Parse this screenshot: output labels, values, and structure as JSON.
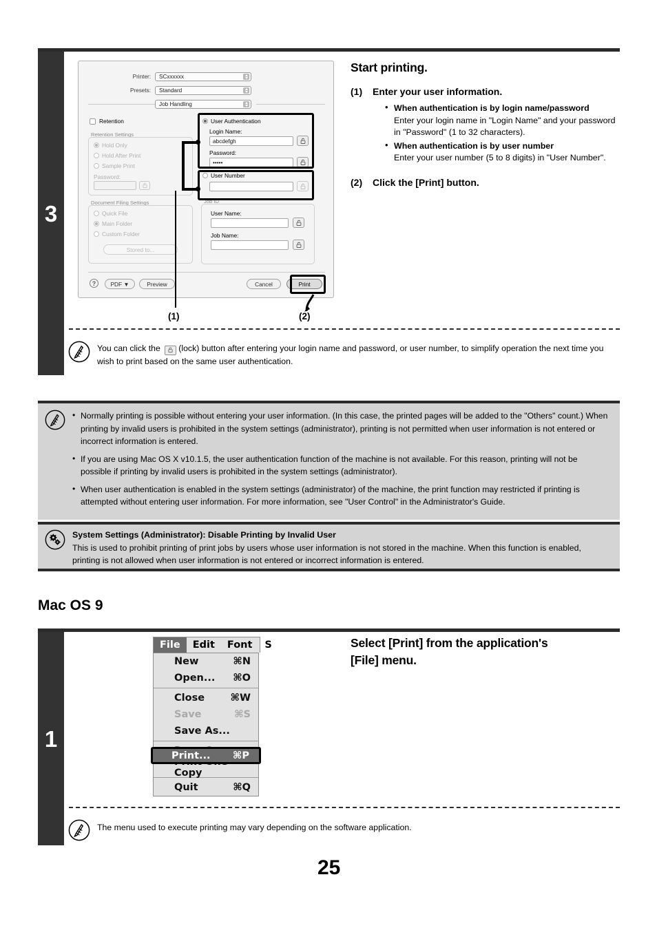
{
  "page": {
    "number": "25"
  },
  "step3": {
    "number": "3",
    "heading": "Start printing.",
    "substeps": [
      {
        "label": "(1)",
        "title": "Enter your user information.",
        "bullets": [
          {
            "head": "When authentication is by login name/password",
            "body": "Enter your login name in \"Login Name\" and your password in \"Password\" (1 to 32 characters)."
          },
          {
            "head": "When authentication is by user number",
            "body": "Enter your user number (5 to 8 digits) in \"User Number\"."
          }
        ]
      },
      {
        "label": "(2)",
        "title": "Click the [Print] button.",
        "bullets": []
      }
    ],
    "note": "You can click the      (lock) button after entering your login name and password, or user number, to simplify operation the next time you wish to print based on the same user authentication.",
    "note_part1": "You can click the",
    "note_part2": "(lock) button after entering your login name and password, or user number, to simplify operation the next time you wish to print based on the same user authentication.",
    "callouts": {
      "one": "(1)",
      "two": "(2)"
    }
  },
  "dialog": {
    "printer_label": "Printer:",
    "printer_value": "SCxxxxxx",
    "presets_label": "Presets:",
    "presets_value": "Standard",
    "pane_value": "Job Handling",
    "retention_checkbox": "Retention",
    "retention_group_caption": "Retention Settings",
    "retention_options": [
      "Hold Only",
      "Hold After Print",
      "Sample Print"
    ],
    "retention_password_label": "Password:",
    "retention_password_value": "",
    "filing_group_caption": "Document Filing Settings",
    "filing_options": [
      "Quick File",
      "Main Folder",
      "Custom Folder"
    ],
    "stored_to_button": "Stored to...",
    "user_auth_radio": "User Authentication",
    "login_name_label": "Login Name:",
    "login_name_value": "abcdefgh",
    "password_label": "Password:",
    "password_value": "•••••",
    "user_number_radio": "User Number",
    "user_number_value": "",
    "jobid_caption": "Job ID",
    "user_name_label": "User Name:",
    "user_name_value": "",
    "job_name_label": "Job Name:",
    "job_name_value": "",
    "help_button": "?",
    "pdf_button": "PDF ▼",
    "preview_button": "Preview",
    "cancel_button": "Cancel",
    "print_button": "Print"
  },
  "notes_box": {
    "items": [
      "Normally printing is possible without entering your user information. (In this case, the printed pages will be added to the \"Others\" count.) When printing by invalid users is prohibited in the system settings (administrator), printing is not permitted when user information is not entered or incorrect information is entered.",
      "If you are using Mac OS X v10.1.5, the user authentication function of the machine is not available. For this reason, printing will not be possible if printing by invalid users is prohibited in the system settings (administrator).",
      "When user authentication is enabled in the system settings (administrator) of the machine, the print function may restricted if printing is attempted without entering user information. For more information, see \"User Control\" in the Administrator's Guide."
    ]
  },
  "sysbox": {
    "title": "System Settings (Administrator): Disable Printing by Invalid User",
    "body": "This is used to prohibit printing of print jobs by users whose user information is not stored in the machine. When this function is enabled, printing is not allowed when user information is not entered or incorrect information is entered."
  },
  "macos9": {
    "section_heading": "Mac OS 9",
    "step_number": "1",
    "heading_line1": "Select [Print] from the application's",
    "heading_line2": "[File] menu.",
    "note": "The menu used to execute printing may vary depending on the software application.",
    "menubar": [
      "File",
      "Edit",
      "Font",
      "S"
    ],
    "menu_items": [
      {
        "label": "New",
        "key": "⌘N",
        "disabled": false
      },
      {
        "label": "Open...",
        "key": "⌘O",
        "disabled": false
      },
      {
        "sep": true
      },
      {
        "label": "Close",
        "key": "⌘W",
        "disabled": false
      },
      {
        "label": "Save",
        "key": "⌘S",
        "disabled": true
      },
      {
        "label": "Save As...",
        "key": "",
        "disabled": false
      },
      {
        "sep": true
      },
      {
        "label": "Page Setup...",
        "key": "",
        "disabled": false
      },
      {
        "label": "Print One Copy",
        "key": "",
        "disabled": false
      },
      {
        "sep": true
      },
      {
        "label": "Quit",
        "key": "⌘Q",
        "disabled": false
      }
    ],
    "highlighted_item": {
      "label": "Print...",
      "key": "⌘P"
    }
  },
  "colors": {
    "step_bar": "#333333",
    "rule": "#2b2b2b",
    "gray_box": "#d4d4d4",
    "highlight": "#6b6b6b"
  }
}
